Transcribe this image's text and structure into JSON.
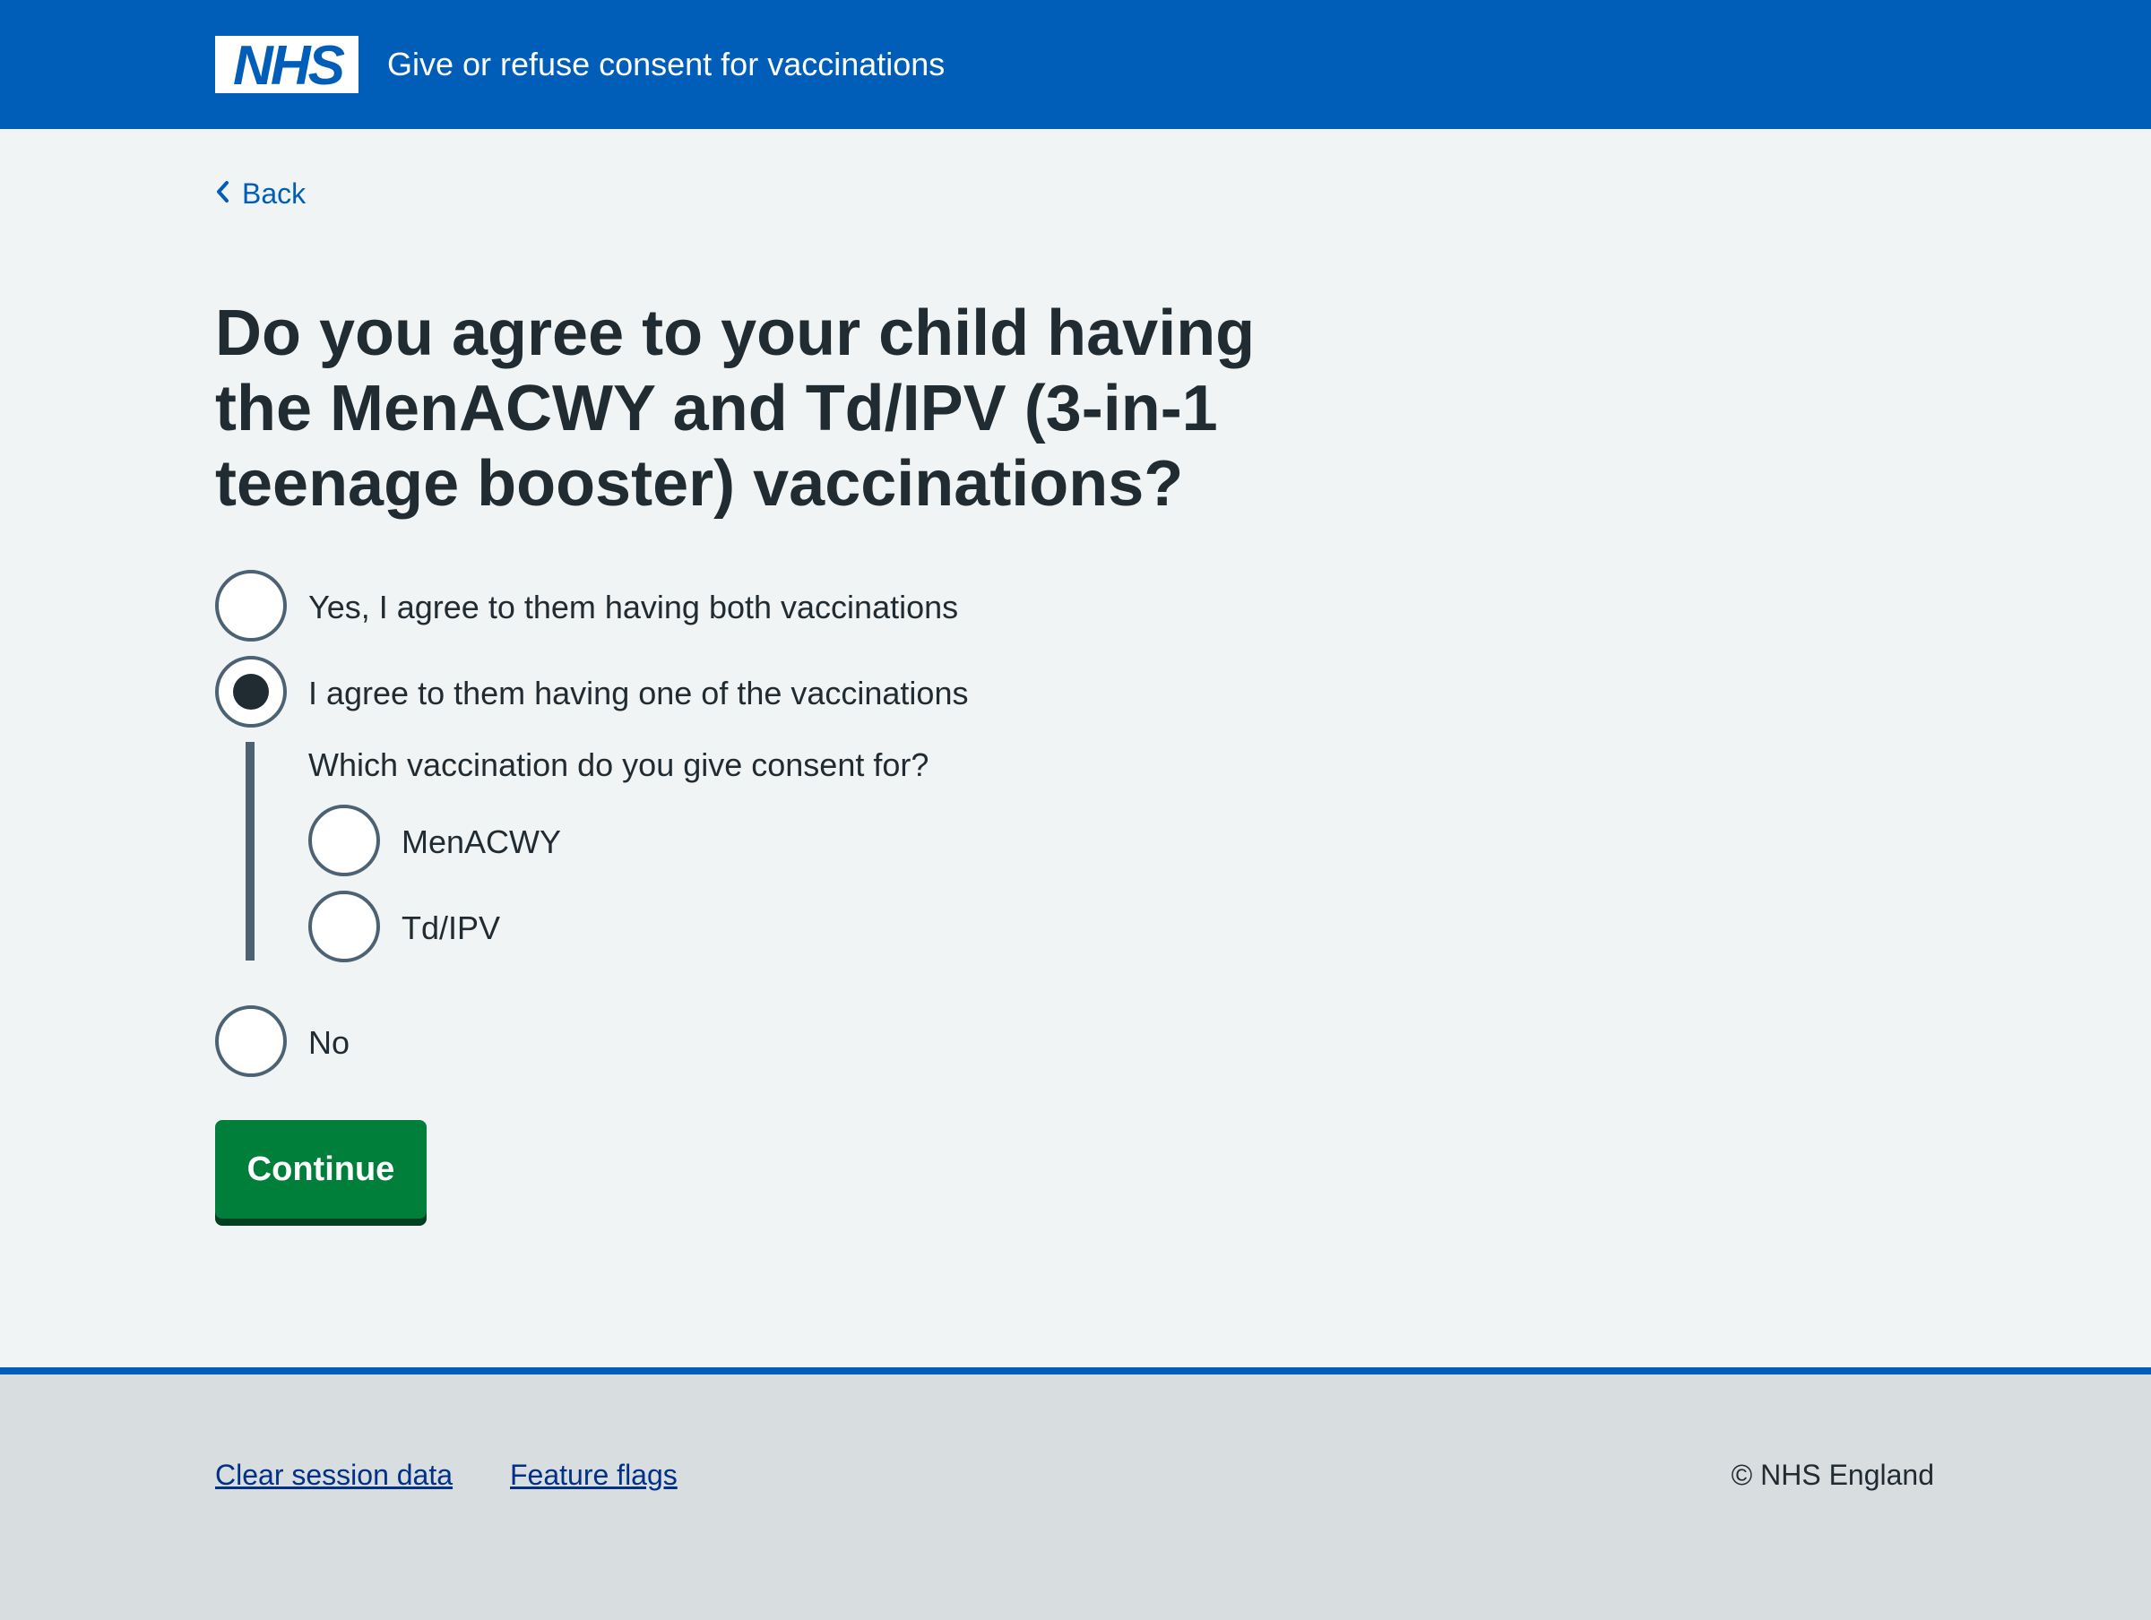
{
  "header": {
    "logo_text": "NHS",
    "service_name": "Give or refuse consent for vaccinations"
  },
  "back_link": {
    "label": "Back"
  },
  "question": {
    "title": "Do you agree to your child having the MenACWY and Td/IPV (3-in-1 teenage booster) vaccinations?",
    "options": [
      {
        "label": "Yes, I agree to them having both vaccinations",
        "selected": false
      },
      {
        "label": "I agree to them having one of the vaccinations",
        "selected": true
      },
      {
        "label": "No",
        "selected": false
      }
    ],
    "conditional": {
      "legend": "Which vaccination do you give consent for?",
      "options": [
        {
          "label": "MenACWY",
          "selected": false
        },
        {
          "label": "Td/IPV",
          "selected": false
        }
      ]
    }
  },
  "continue_button": {
    "label": "Continue"
  },
  "footer": {
    "links": [
      "Clear session data",
      "Feature flags"
    ],
    "copyright": "© NHS England"
  },
  "colors": {
    "brand_blue": "#005eb8",
    "button_green": "#007f3b",
    "text": "#212b32",
    "page_background": "#f0f4f5",
    "footer_background": "#d8dde0"
  }
}
